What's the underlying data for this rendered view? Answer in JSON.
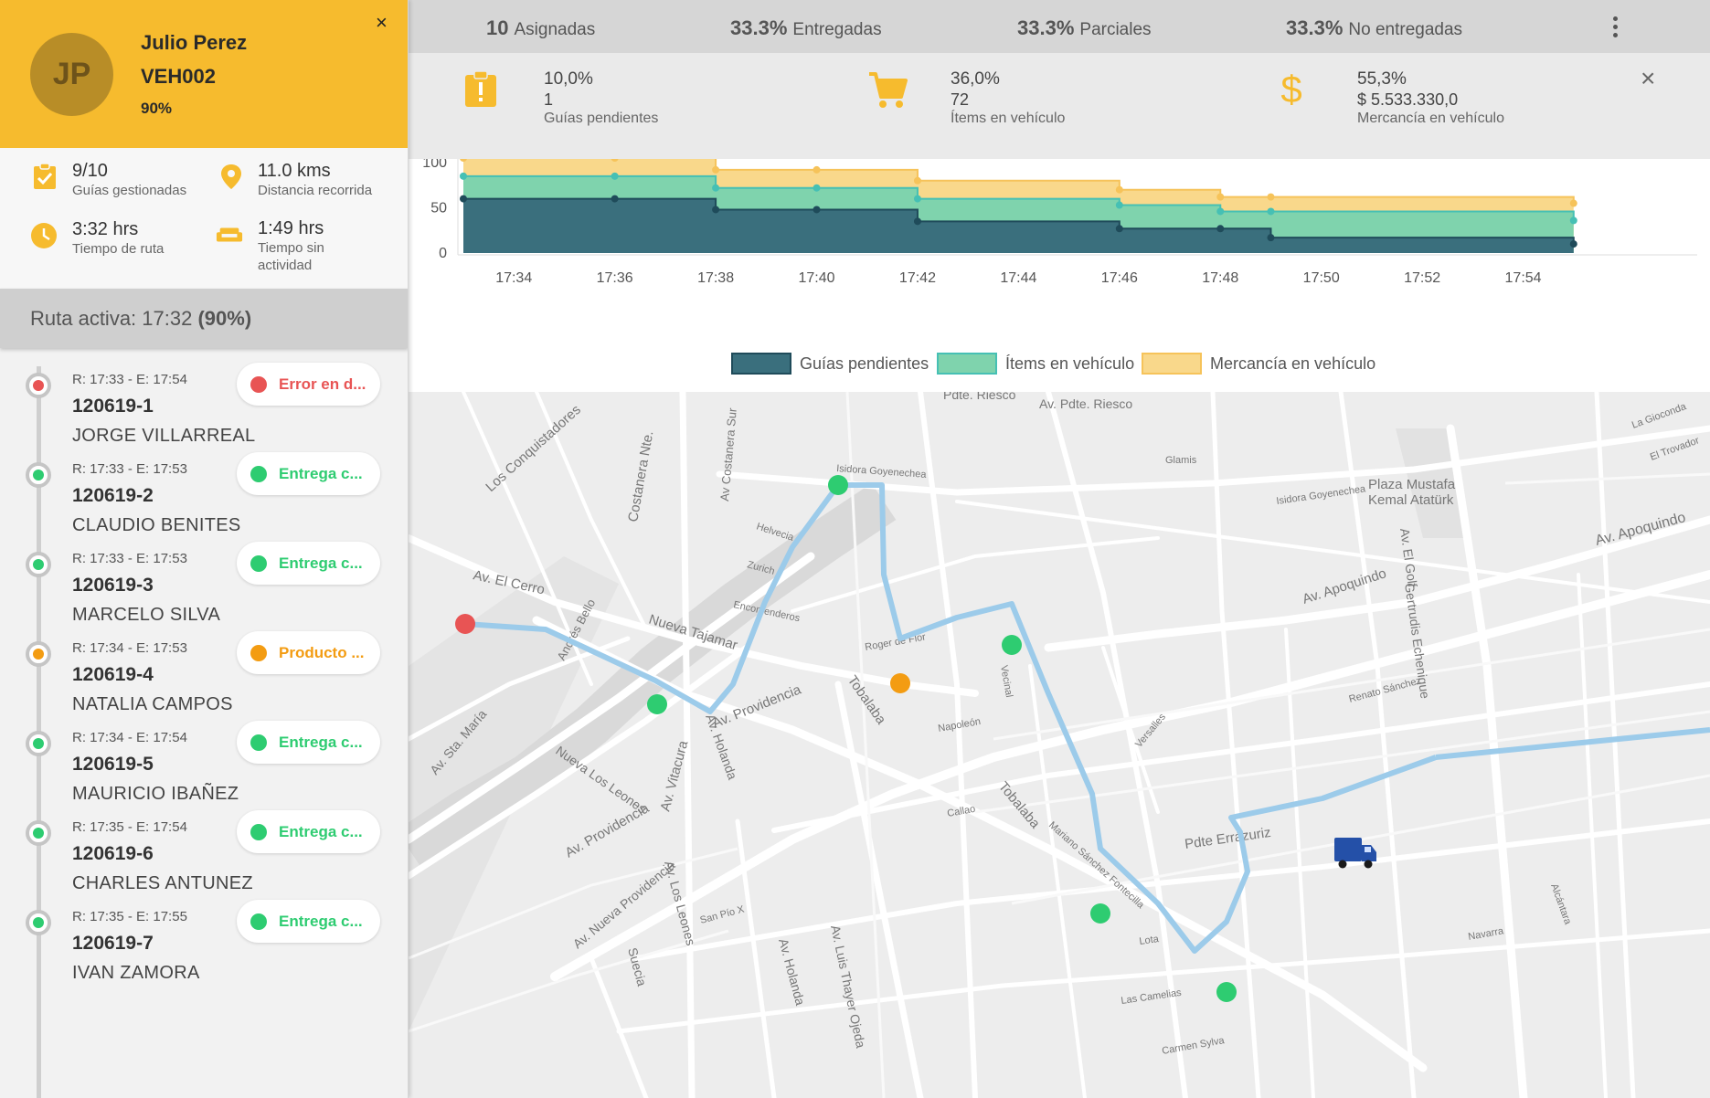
{
  "driver": {
    "initials": "JP",
    "name": "Julio Perez",
    "vehicle": "VEH002",
    "progress": "90%",
    "close": "×"
  },
  "stats": {
    "guides_value": "9/10",
    "guides_label": "Guías gestionadas",
    "distance_value": "11.0 kms",
    "distance_label": "Distancia recorrida",
    "route_time_value": "3:32 hrs",
    "route_time_label": "Tiempo de ruta",
    "idle_value": "1:49 hrs",
    "idle_label_1": "Tiempo sin",
    "idle_label_2": "actividad"
  },
  "route": {
    "label": "Ruta activa: 17:32",
    "pct": "(90%)"
  },
  "deliveries": [
    {
      "time": "R: 17:33 - E: 17:54",
      "code": "120619-1",
      "name": "JORGE VILLARREAL",
      "status": "Error en d...",
      "color": "#e85454"
    },
    {
      "time": "R: 17:33 - E: 17:53",
      "code": "120619-2",
      "name": "CLAUDIO BENITES",
      "status": "Entrega c...",
      "color": "#2ecc71"
    },
    {
      "time": "R: 17:33 - E: 17:53",
      "code": "120619-3",
      "name": "MARCELO SILVA",
      "status": "Entrega c...",
      "color": "#2ecc71"
    },
    {
      "time": "R: 17:34 - E: 17:53",
      "code": "120619-4",
      "name": "NATALIA CAMPOS",
      "status": "Producto ...",
      "color": "#f39c12"
    },
    {
      "time": "R: 17:34 - E: 17:54",
      "code": "120619-5",
      "name": "MAURICIO IBAÑEZ",
      "status": "Entrega c...",
      "color": "#2ecc71"
    },
    {
      "time": "R: 17:35 - E: 17:54",
      "code": "120619-6",
      "name": "CHARLES ANTUNEZ",
      "status": "Entrega c...",
      "color": "#2ecc71"
    },
    {
      "time": "R: 17:35 - E: 17:55",
      "code": "120619-7",
      "name": "IVAN ZAMORA",
      "status": "Entrega c...",
      "color": "#2ecc71"
    }
  ],
  "topstats": {
    "assigned_value": "10",
    "assigned_label": "Asignadas",
    "delivered_value": "33.3%",
    "delivered_label": "Entregadas",
    "partial_value": "33.3%",
    "partial_label": "Parciales",
    "undelivered_value": "33.3%",
    "undelivered_label": "No entregadas"
  },
  "metrics": {
    "pending_pct": "10,0%",
    "pending_num": "1",
    "pending_label": "Guías pendientes",
    "items_pct": "36,0%",
    "items_num": "72",
    "items_label": "Ítems en vehículo",
    "goods_pct": "55,3%",
    "goods_num": "$ 5.533.330,0",
    "goods_label": "Mercancía en vehículo",
    "close": "×"
  },
  "colors": {
    "accent": "#f6bb2e",
    "pending": "#3a6f7d",
    "items": "#7fd3ad",
    "goods": "#f9d88b",
    "route": "#9ccbea",
    "ok": "#2ecc71",
    "error": "#e85454",
    "warning": "#f39c12"
  },
  "chart_data": {
    "type": "area",
    "x": [
      "17:33",
      "17:36",
      "17:38",
      "17:40",
      "17:42",
      "17:46",
      "17:48",
      "17:49",
      "17:55"
    ],
    "series": [
      {
        "name": "Guías pendientes",
        "values": [
          60,
          60,
          48,
          48,
          35,
          27,
          27,
          17,
          10
        ]
      },
      {
        "name": "Ítems en vehículo",
        "values": [
          85,
          85,
          72,
          72,
          60,
          53,
          46,
          46,
          36
        ]
      },
      {
        "name": "Mercancía en vehículo",
        "values": [
          105,
          105,
          92,
          92,
          80,
          70,
          62,
          62,
          55
        ]
      }
    ],
    "x_ticks": [
      "17:34",
      "17:36",
      "17:38",
      "17:40",
      "17:42",
      "17:44",
      "17:46",
      "17:48",
      "17:50",
      "17:52",
      "17:54"
    ],
    "y_ticks": [
      0,
      50,
      100
    ],
    "ylim": [
      0,
      100
    ],
    "legend": "bottom-center",
    "grid": false
  },
  "map": {
    "labels": [
      "Av. Pdte. Riesco",
      "Pdte. Riesco",
      "Los Conquistadores",
      "Costanera Nte.",
      "Av Costanera Sur",
      "Isidora Goyenechea",
      "Plaza Mustafa",
      "Kemal Atatürk",
      "Av. Apoquindo",
      "Av. El Cerro",
      "Nueva Tajamar",
      "Av. Providencia",
      "Tobalaba",
      "Pdte Errázuriz",
      "Av. Vitacura",
      "Av. Holanda",
      "Nueva Los Leones",
      "Av. Los Leones",
      "Av. Luis Thayer Ojeda",
      "Av. Sta. María",
      "Andrés Bello",
      "Helvecia",
      "Zurich",
      "Encomenderos",
      "Roger de Flor",
      "Napoleón",
      "Callao",
      "Renato Sánchez",
      "Av. El Golf",
      "Glamis",
      "Suecia",
      "Av. Nueva Providencia",
      "Las Camelias",
      "Carmen Sylva",
      "Navarra",
      "San Pío X",
      "Lota",
      "Mariano Sánchez Fontecilla",
      "Gertrudis Echenique",
      "La Gioconda",
      "El Trovador",
      "Alcántara",
      "Vecinal",
      "Versalles"
    ]
  }
}
